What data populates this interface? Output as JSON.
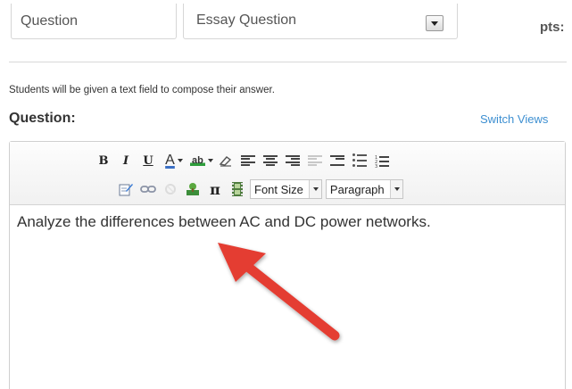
{
  "header": {
    "question_title_value": "Question",
    "question_type_value": "Essay Question",
    "points_label": "pts:"
  },
  "helper_text": "Students will be given a text field to compose their answer.",
  "question_label": "Question:",
  "switch_views_label": "Switch Views",
  "toolbar": {
    "bold": "B",
    "italic": "I",
    "underline": "U",
    "font_color": "A",
    "highlight": "ab",
    "math": "π",
    "font_size_label": "Font Size",
    "paragraph_label": "Paragraph"
  },
  "editor_content": "Analyze the differences between AC and DC power networks.",
  "colors": {
    "link": "#3d8fd1",
    "annotation_arrow": "#e43c33"
  }
}
